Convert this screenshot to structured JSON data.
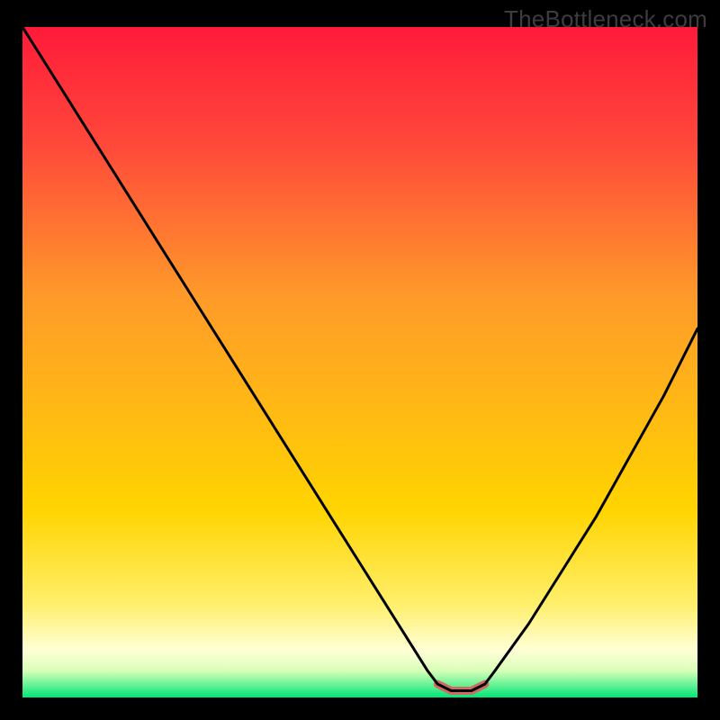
{
  "watermark": "TheBottleneck.com",
  "chart_data": {
    "type": "line",
    "title": "",
    "xlabel": "",
    "ylabel": "",
    "xlim": [
      0,
      200
    ],
    "ylim": [
      0,
      100
    ],
    "x": [
      0,
      10,
      20,
      30,
      40,
      50,
      60,
      70,
      80,
      90,
      100,
      110,
      120,
      123,
      127,
      130,
      133,
      137,
      140,
      150,
      160,
      170,
      180,
      190,
      200
    ],
    "values": [
      100,
      92,
      84,
      76,
      68,
      60,
      52,
      44,
      36,
      28,
      20,
      12,
      4,
      2,
      1,
      1,
      1,
      2,
      4,
      11,
      19,
      27,
      36,
      45,
      55
    ],
    "xtick_labels": [],
    "ytick_labels": [],
    "background_gradient": {
      "top_color": "#ff1a3a",
      "mid_color": "#ffd400",
      "bottom_cream": "#ffffd6",
      "bottom_green": "#00e676"
    },
    "series_color": "#000000",
    "marker": {
      "x_start": 123,
      "x_end": 137,
      "color": "#d16a5f"
    }
  }
}
